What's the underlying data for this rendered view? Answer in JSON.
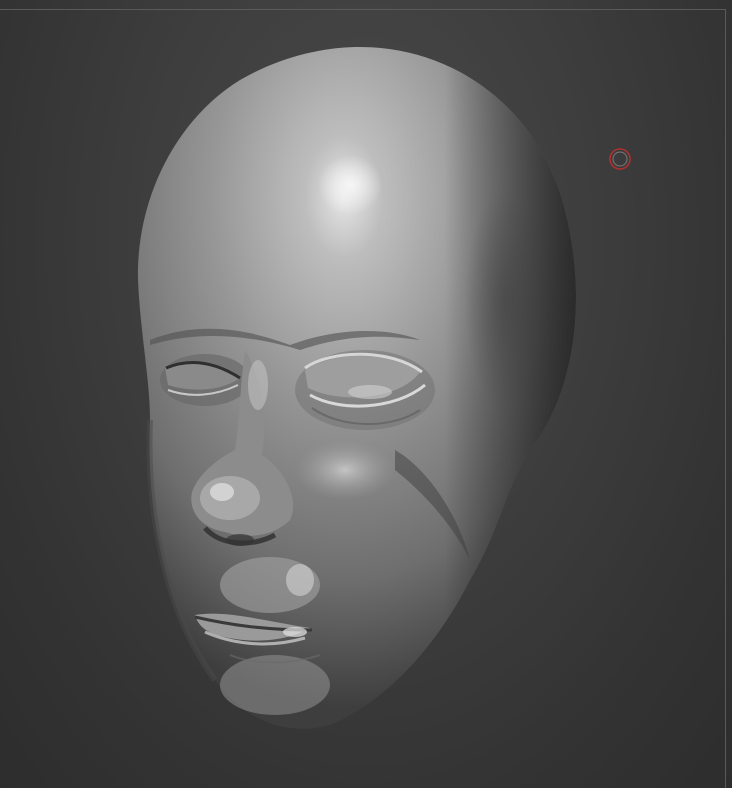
{
  "viewport": {
    "background_color": "#3a3a3a",
    "frame_color": "#5a5a5a"
  },
  "model": {
    "subject": "sculpted-head",
    "material_color": "#9a9a9a"
  },
  "cursor": {
    "icon": "brush-cursor-icon",
    "color": "#b03030"
  }
}
